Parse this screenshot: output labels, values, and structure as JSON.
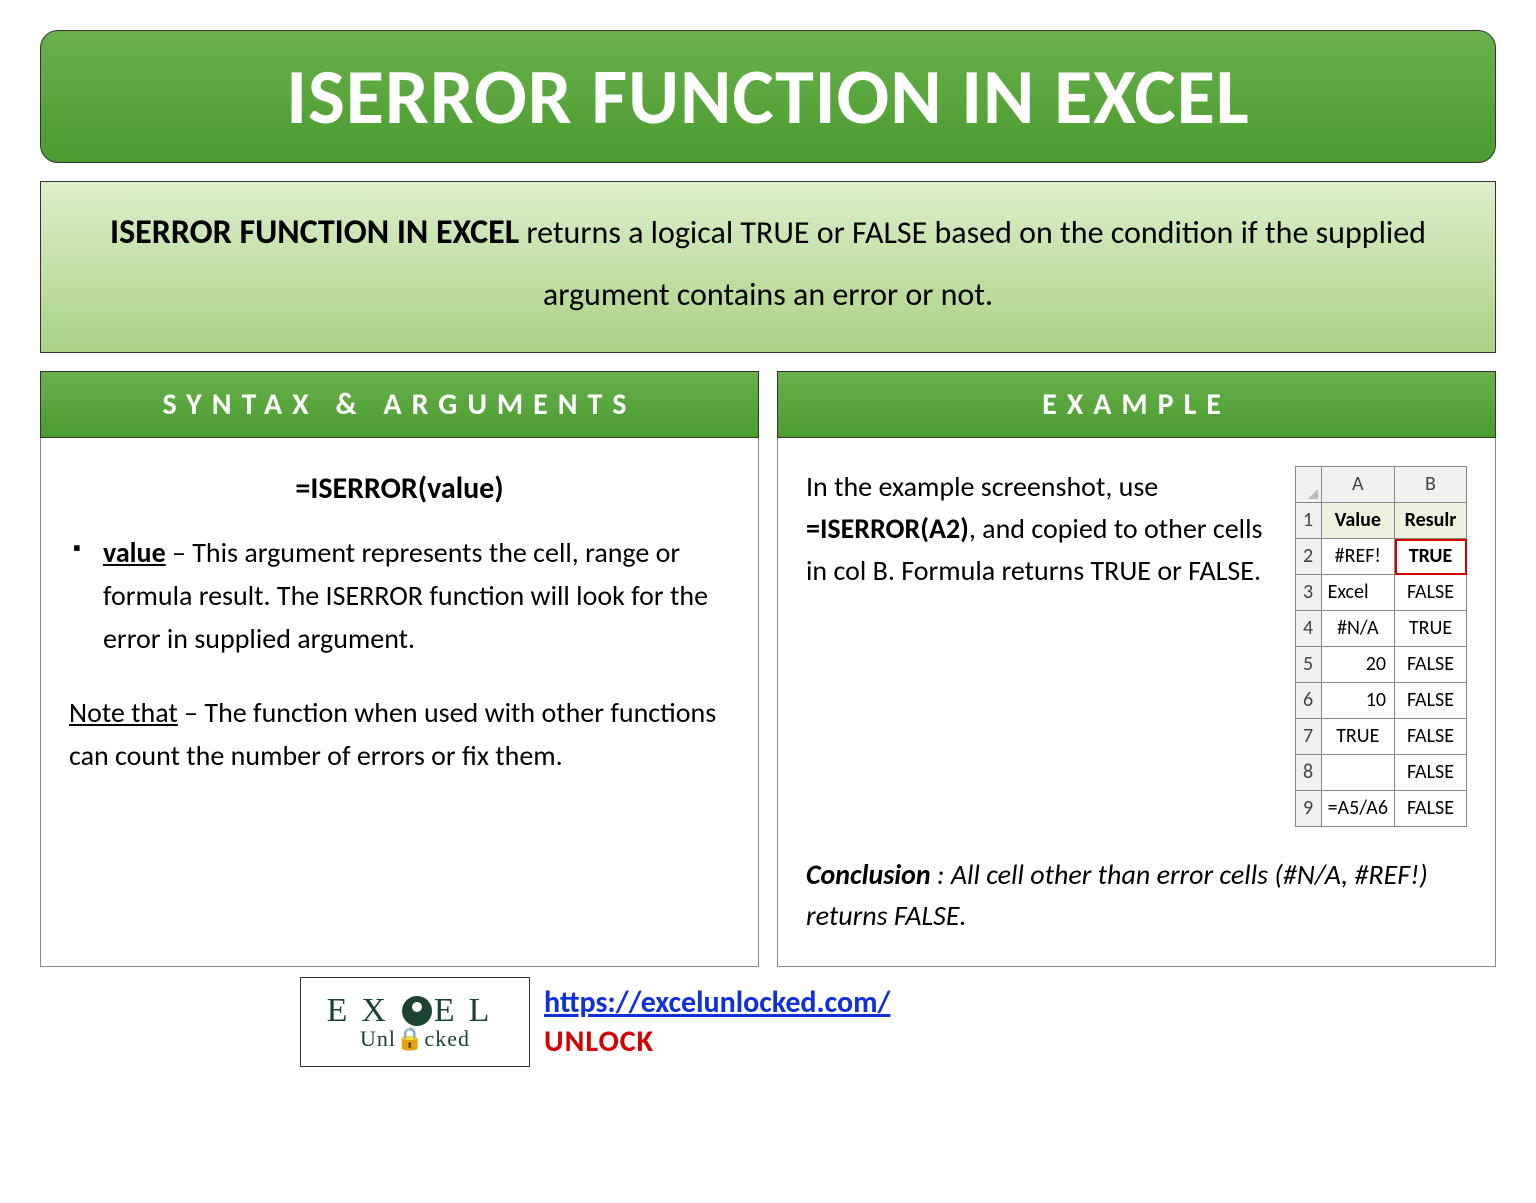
{
  "title": "ISERROR FUNCTION IN EXCEL",
  "description": {
    "lead": "ISERROR FUNCTION IN EXCEL",
    "rest": " returns a logical TRUE or FALSE based on the condition if the supplied argument contains an error or not."
  },
  "syntax": {
    "header": "SYNTAX & ARGUMENTS",
    "formula": "=ISERROR(value)",
    "arg_name": "value",
    "arg_desc": " – This argument represents the cell, range or formula result. The ISERROR function will look for the error in supplied argument.",
    "note_lead": "Note that",
    "note_rest": " – The function when used with other functions can count the number of errors or fix them."
  },
  "example": {
    "header": "EXAMPLE",
    "text1": "In the example screenshot, use ",
    "formula": "=ISERROR(A2)",
    "text2": ", and copied to other cells in col B. Formula returns TRUE or FALSE.",
    "conclusion_lead": "Conclusion",
    "conclusion_rest": " : All cell other than error cells (#N/A, #REF!) returns FALSE."
  },
  "table": {
    "colA": "A",
    "colB": "B",
    "headerA": "Value",
    "headerB": "Resulr",
    "rows": [
      {
        "n": "1"
      },
      {
        "n": "2",
        "a": "#REF!",
        "b": "TRUE",
        "a_align": "center",
        "b_highlight": true
      },
      {
        "n": "3",
        "a": "Excel",
        "b": "FALSE",
        "a_align": "left"
      },
      {
        "n": "4",
        "a": "#N/A",
        "b": "TRUE",
        "a_align": "center"
      },
      {
        "n": "5",
        "a": "20",
        "b": "FALSE",
        "a_align": "right"
      },
      {
        "n": "6",
        "a": "10",
        "b": "FALSE",
        "a_align": "right"
      },
      {
        "n": "7",
        "a": "TRUE",
        "b": "FALSE",
        "a_align": "center"
      },
      {
        "n": "8",
        "a": "",
        "b": "FALSE",
        "a_align": "center"
      },
      {
        "n": "9",
        "a": "=A5/A6",
        "b": "FALSE",
        "a_align": "left"
      }
    ]
  },
  "footer": {
    "logo_top_left": "EX",
    "logo_top_right": "EL",
    "logo_bottom": "Unl🔒cked",
    "link": "https://excelunlocked.com/",
    "unlock": "UNLOCK"
  }
}
